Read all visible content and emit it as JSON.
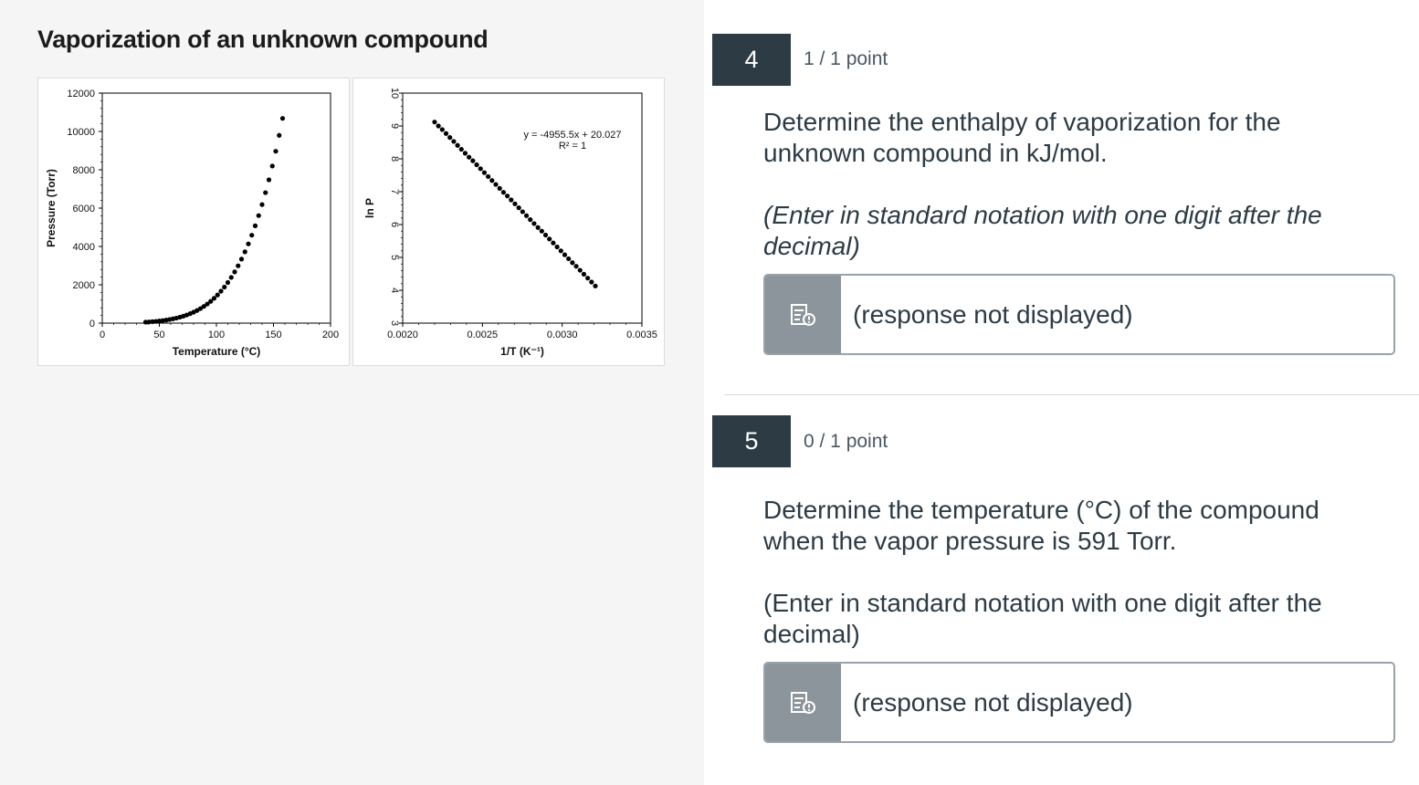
{
  "stimulus": {
    "title": "Vaporization of an unknown compound"
  },
  "chart_data": [
    {
      "type": "scatter",
      "title": "",
      "xlabel": "Temperature (°C)",
      "ylabel": "Pressure (Torr)",
      "xlim": [
        0,
        200
      ],
      "ylim": [
        0,
        12000
      ],
      "x_ticks": [
        "0",
        "50",
        "100",
        "150",
        "200"
      ],
      "y_ticks": [
        "0",
        "2000",
        "4000",
        "6000",
        "8000",
        "10000",
        "12000"
      ],
      "points": [
        [
          38,
          52
        ],
        [
          41,
          63
        ],
        [
          44,
          77
        ],
        [
          47,
          93
        ],
        [
          50,
          112
        ],
        [
          53,
          134
        ],
        [
          56,
          160
        ],
        [
          59,
          190
        ],
        [
          62,
          225
        ],
        [
          65,
          265
        ],
        [
          68,
          311
        ],
        [
          71,
          364
        ],
        [
          74,
          424
        ],
        [
          77,
          493
        ],
        [
          80,
          571
        ],
        [
          83,
          659
        ],
        [
          86,
          759
        ],
        [
          89,
          871
        ],
        [
          92,
          997
        ],
        [
          95,
          1138
        ],
        [
          98,
          1296
        ],
        [
          101,
          1471
        ],
        [
          104,
          1666
        ],
        [
          107,
          1882
        ],
        [
          110,
          2120
        ],
        [
          113,
          2383
        ],
        [
          116,
          2673
        ],
        [
          119,
          2991
        ],
        [
          122,
          3339
        ],
        [
          125,
          3720
        ],
        [
          128,
          4135
        ],
        [
          131,
          4587
        ],
        [
          134,
          5077
        ],
        [
          137,
          5609
        ],
        [
          140,
          6184
        ],
        [
          143,
          6806
        ],
        [
          146,
          7475
        ],
        [
          149,
          8195
        ],
        [
          152,
          8968
        ],
        [
          155,
          9796
        ],
        [
          158,
          10682
        ]
      ]
    },
    {
      "type": "scatter",
      "title": "",
      "xlabel": "1/T (K⁻¹)",
      "ylabel": "ln P",
      "xlim": [
        0.002,
        0.0035
      ],
      "ylim": [
        3,
        10
      ],
      "x_ticks": [
        "0.0020",
        "0.0025",
        "0.0030",
        "0.0035"
      ],
      "y_ticks": [
        "3",
        "4",
        "5",
        "6",
        "7",
        "8",
        "9",
        "10"
      ],
      "annotation": [
        "y = -4955.5x + 20.027",
        "R² = 1"
      ],
      "points": [
        [
          0.0022,
          9.12
        ],
        [
          0.002224,
          9.0
        ],
        [
          0.002248,
          8.89
        ],
        [
          0.002272,
          8.77
        ],
        [
          0.002296,
          8.65
        ],
        [
          0.00232,
          8.53
        ],
        [
          0.002344,
          8.41
        ],
        [
          0.002368,
          8.29
        ],
        [
          0.002392,
          8.17
        ],
        [
          0.002416,
          8.05
        ],
        [
          0.00244,
          7.94
        ],
        [
          0.002464,
          7.82
        ],
        [
          0.002488,
          7.7
        ],
        [
          0.002512,
          7.58
        ],
        [
          0.002536,
          7.46
        ],
        [
          0.00256,
          7.34
        ],
        [
          0.002584,
          7.22
        ],
        [
          0.002608,
          7.1
        ],
        [
          0.002632,
          6.98
        ],
        [
          0.002656,
          6.87
        ],
        [
          0.00268,
          6.75
        ],
        [
          0.002704,
          6.63
        ],
        [
          0.002728,
          6.51
        ],
        [
          0.002752,
          6.39
        ],
        [
          0.002776,
          6.27
        ],
        [
          0.0028,
          6.15
        ],
        [
          0.002824,
          6.03
        ],
        [
          0.002848,
          5.91
        ],
        [
          0.002872,
          5.8
        ],
        [
          0.002896,
          5.68
        ],
        [
          0.00292,
          5.56
        ],
        [
          0.002944,
          5.44
        ],
        [
          0.002968,
          5.32
        ],
        [
          0.002992,
          5.2
        ],
        [
          0.003016,
          5.08
        ],
        [
          0.00304,
          4.96
        ],
        [
          0.003064,
          4.84
        ],
        [
          0.003088,
          4.73
        ],
        [
          0.003112,
          4.61
        ],
        [
          0.003136,
          4.49
        ],
        [
          0.00316,
          4.37
        ],
        [
          0.003184,
          4.25
        ],
        [
          0.003208,
          4.13
        ]
      ]
    }
  ],
  "questions": [
    {
      "number": "4",
      "points": "1 / 1 point",
      "text_lines": [
        "Determine the enthalpy of vaporization for the",
        "unknown compound in kJ/mol."
      ],
      "hint_lines": [
        "(Enter in standard notation with one digit after the",
        "decimal)"
      ],
      "response": "(response not displayed)",
      "response_icon": "response-hidden-icon"
    },
    {
      "number": "5",
      "points": "0 / 1 point",
      "text_lines": [
        "Determine the temperature (°C) of the compound",
        "when the vapor pressure is 591 Torr."
      ],
      "hint_lines": [
        "(Enter in standard notation with one digit after the",
        "decimal)"
      ],
      "response": "(response not displayed)",
      "response_icon": "response-hidden-icon"
    }
  ]
}
